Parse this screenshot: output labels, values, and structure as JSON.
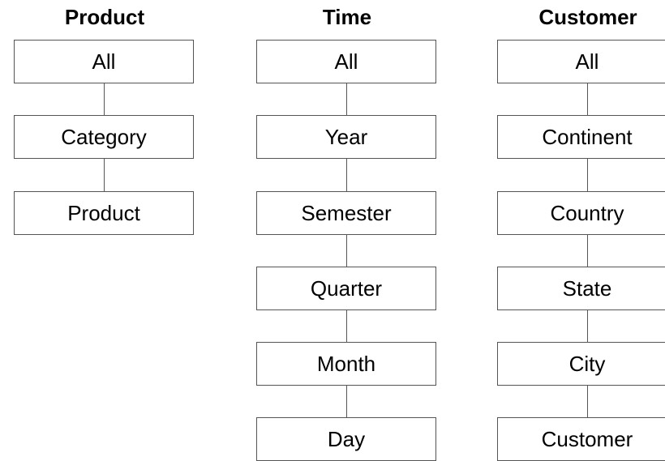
{
  "hierarchies": [
    {
      "title": "Product",
      "levels": [
        "All",
        "Category",
        "Product"
      ]
    },
    {
      "title": "Time",
      "levels": [
        "All",
        "Year",
        "Semester",
        "Quarter",
        "Month",
        "Day"
      ]
    },
    {
      "title": "Customer",
      "levels": [
        "All",
        "Continent",
        "Country",
        "State",
        "City",
        "Customer"
      ]
    }
  ]
}
